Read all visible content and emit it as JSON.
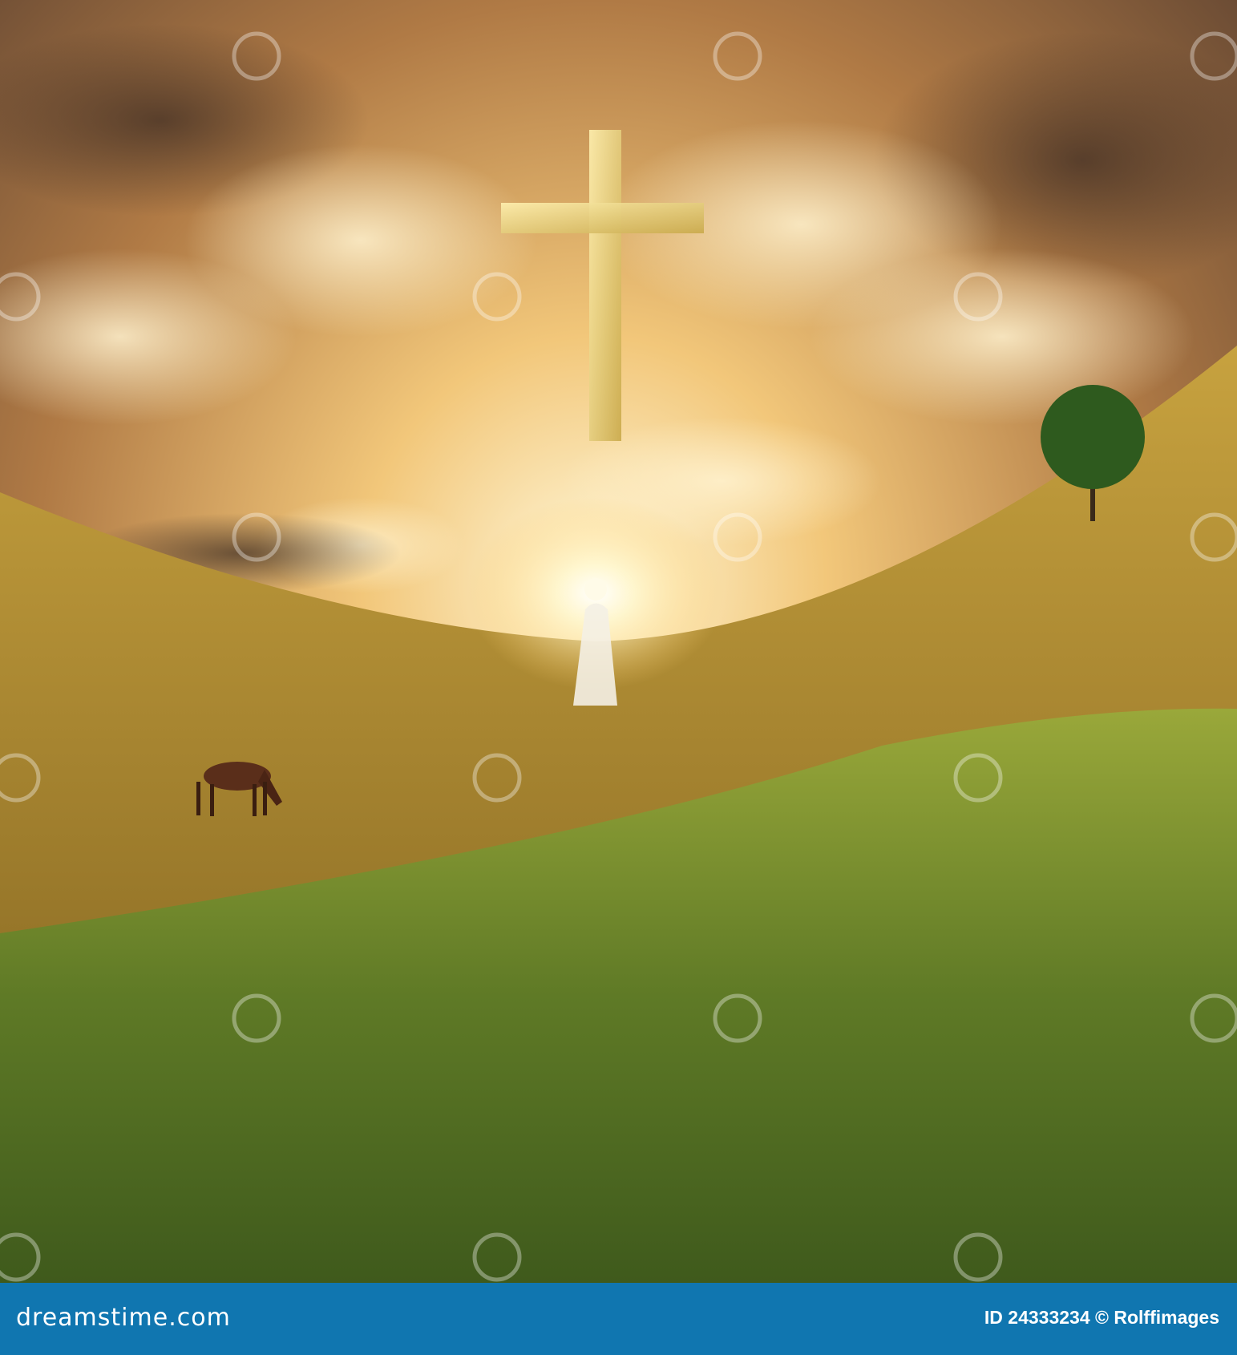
{
  "image": {
    "subjects": [
      "cross",
      "robed-figure",
      "horse",
      "tree",
      "fields",
      "clouds"
    ],
    "watermark": "dreamstime"
  },
  "footer": {
    "logo": "dreamstime.com",
    "credit": "ID 24333234 © Rolffimages"
  },
  "colors": {
    "footer_bg": "#1076b0",
    "sky_glow": "#fff3c8",
    "field_gold": "#a88a2a",
    "field_green": "#6e8a2a"
  }
}
